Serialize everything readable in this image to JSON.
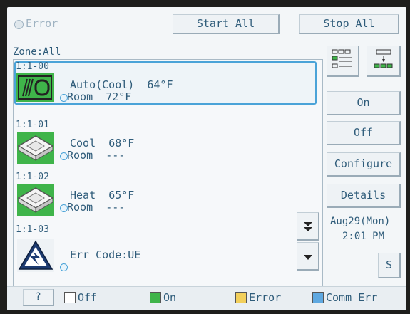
{
  "header": {
    "error_label": "Error",
    "start_all": "Start All",
    "stop_all": "Stop All"
  },
  "zone_filter": "Zone:All",
  "zones": [
    {
      "id": "1:1-00",
      "mode": "Auto(Cool)",
      "setpoint": "64°F",
      "room_label": "Room",
      "room_value": "72°F",
      "status": "On"
    },
    {
      "id": "1:1-01",
      "mode": "Cool",
      "setpoint": "68°F",
      "room_label": "Room",
      "room_value": "---",
      "status": "On"
    },
    {
      "id": "1:1-02",
      "mode": "Heat",
      "setpoint": "65°F",
      "room_label": "Room",
      "room_value": "---",
      "status": "On"
    },
    {
      "id": "1:1-03",
      "mode": "Err Code:UE",
      "status": "Error"
    }
  ],
  "side_buttons": {
    "on": "On",
    "off": "Off",
    "configure": "Configure",
    "details": "Details"
  },
  "clock": {
    "date": "Aug29(Mon)",
    "time": "2:01 PM"
  },
  "s_button": "S",
  "help_button": "?",
  "legend": [
    {
      "label": "Off",
      "color": "#ffffff"
    },
    {
      "label": "On",
      "color": "#3fb44a"
    },
    {
      "label": "Error",
      "color": "#f2cf5b"
    },
    {
      "label": "Comm Err",
      "color": "#5fa8e0"
    }
  ],
  "colors": {
    "text": "#2f5c7a",
    "on_green": "#3fb44a",
    "selection": "#4aa3d8"
  },
  "icons": [
    "radio-icon",
    "list-view-icon",
    "floor-view-icon",
    "fan-coil-icon",
    "cassette-icon",
    "warning-icon",
    "page-down-icon",
    "scroll-down-icon"
  ]
}
